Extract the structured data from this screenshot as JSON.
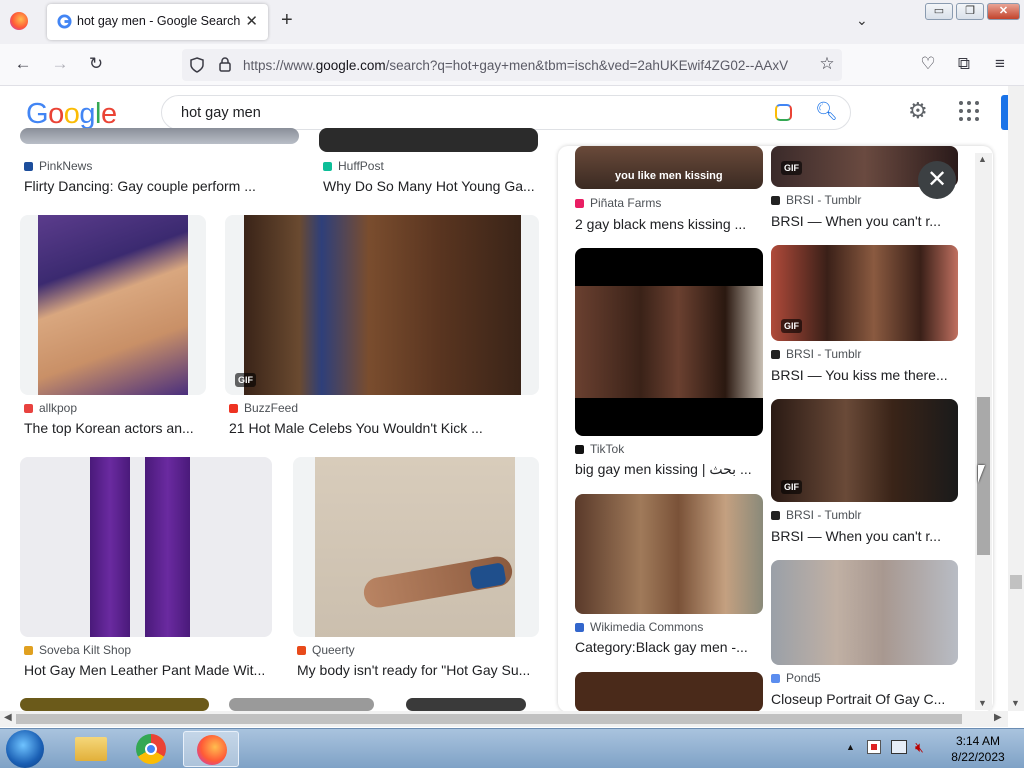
{
  "browser": {
    "tab_title": "hot gay men - Google Search",
    "tab_close": "✕",
    "new_tab": "+",
    "url_prefix": "https://www.",
    "url_domain": "google.com",
    "url_rest": "/search?q=hot+gay+men&tbm=isch&ved=2ahUKEwif4ZG02--AAxV",
    "window_buttons": [
      "▭",
      "❐",
      "✕"
    ],
    "icons": [
      "back-icon",
      "forward-icon",
      "reload-icon",
      "shield-icon",
      "lock-icon",
      "star-icon",
      "pocket-icon",
      "extensions-icon",
      "menu-icon"
    ]
  },
  "google": {
    "logo_letters": [
      "G",
      "o",
      "o",
      "g",
      "l",
      "e"
    ],
    "logo_colors": [
      "#4285f4",
      "#ea4335",
      "#fbbc05",
      "#4285f4",
      "#34a853",
      "#ea4335"
    ],
    "query": "hot gay men"
  },
  "results": {
    "top_row": [
      {
        "source": "PinkNews",
        "caption": "Flirty Dancing: Gay couple perform ...",
        "color": "#1d4e9c"
      },
      {
        "source": "HuffPost",
        "caption": "Why Do So Many Hot Young Ga...",
        "color": "#0dbe98"
      }
    ],
    "row2": [
      {
        "source": "allkpop",
        "caption": "The top Korean actors an...",
        "color": "#e8423f"
      },
      {
        "source": "BuzzFeed",
        "caption": "21 Hot Male Celebs You Wouldn't Kick ...",
        "color": "#ee3322",
        "gif": "GIF"
      }
    ],
    "row3": [
      {
        "source": "Soveba Kilt Shop",
        "caption": "Hot Gay Men Leather Pant Made Wit...",
        "color": "#e0a020"
      },
      {
        "source": "Queerty",
        "caption": "My body isn't ready for \"Hot Gay Su...",
        "color": "#e84a1a"
      }
    ]
  },
  "panel": {
    "left_col": [
      {
        "source": "Piñata Farms",
        "caption": "2 gay black mens kissing ...",
        "overlay": "you like men kissing",
        "color": "#e91e63"
      },
      {
        "source": "TikTok",
        "caption": "big gay men kissing | بحث ...",
        "color": "#111111"
      },
      {
        "source": "Wikimedia Commons",
        "caption": "Category:Black gay men -...",
        "color": "#3366cc"
      }
    ],
    "right_col": [
      {
        "source": "BRSI - Tumblr",
        "caption": "BRSI — When you can't r...",
        "gif": "GIF",
        "color": "#222222"
      },
      {
        "source": "BRSI - Tumblr",
        "caption": "BRSI — You kiss me there...",
        "gif": "GIF",
        "color": "#222222"
      },
      {
        "source": "BRSI - Tumblr",
        "caption": "BRSI — When you can't r...",
        "gif": "GIF",
        "color": "#222222"
      },
      {
        "source": "Pond5",
        "caption": "Closeup Portrait Of Gay C...",
        "color": "#5b8def"
      }
    ],
    "close_label": "✕"
  },
  "taskbar": {
    "time": "3:14 AM",
    "date": "8/22/2023",
    "apps": [
      "start-button",
      "file-explorer-icon",
      "chrome-icon",
      "firefox-icon"
    ]
  }
}
